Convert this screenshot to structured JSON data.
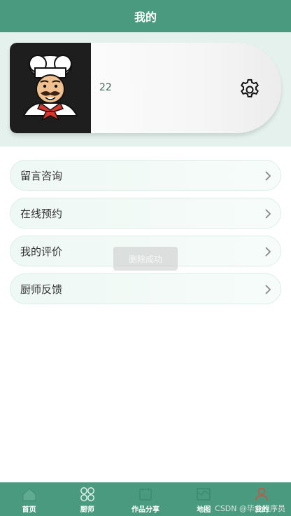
{
  "header": {
    "title": "我的"
  },
  "profile": {
    "username": "22"
  },
  "menu": {
    "items": [
      {
        "label": "留言咨询"
      },
      {
        "label": "在线预约"
      },
      {
        "label": "我的评价"
      },
      {
        "label": "厨师反馈"
      }
    ]
  },
  "toast": {
    "text": "删除成功"
  },
  "tabbar": {
    "items": [
      {
        "label": "首页",
        "icon": "home-icon"
      },
      {
        "label": "厨师",
        "icon": "grid-icon"
      },
      {
        "label": "作品分享",
        "icon": "share-icon"
      },
      {
        "label": "地图",
        "icon": "map-icon"
      },
      {
        "label": "我的",
        "icon": "user-icon",
        "active": true
      }
    ]
  },
  "watermark": {
    "text": "CSDN @毕业程序员"
  },
  "colors": {
    "primary": "#4a9a80",
    "background_tint": "#e4f1ec",
    "active_tab_icon": "#b85c4b"
  }
}
